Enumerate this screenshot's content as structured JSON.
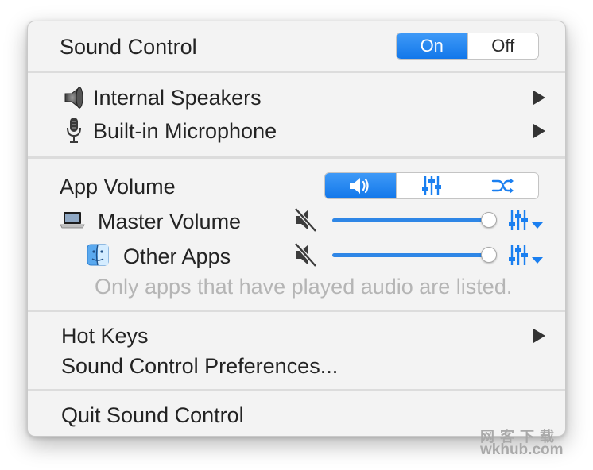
{
  "sound_control": {
    "label": "Sound Control",
    "toggle": {
      "on_label": "On",
      "off_label": "Off",
      "selected": "On"
    }
  },
  "devices": [
    {
      "label": "Internal Speakers",
      "icon": "speaker-icon"
    },
    {
      "label": "Built-in Microphone",
      "icon": "microphone-icon"
    }
  ],
  "app_volume": {
    "label": "App Volume",
    "mode_tabs": [
      {
        "icon": "volume-icon",
        "selected": true
      },
      {
        "icon": "equalizer-icon",
        "selected": false
      },
      {
        "icon": "shuffle-icon",
        "selected": false
      }
    ],
    "rows": [
      {
        "label": "Master Volume",
        "icon": "laptop-icon",
        "muted": true,
        "volume": 1.0
      },
      {
        "label": "Other Apps",
        "icon": "finder-icon",
        "muted": true,
        "volume": 1.0
      }
    ],
    "note": "Only apps that have played audio are listed."
  },
  "menu": {
    "hot_keys": "Hot Keys",
    "preferences": "Sound Control Preferences...",
    "quit": "Quit Sound Control"
  },
  "watermark": {
    "line1": "网 客 下 载",
    "line2": "wkhub.com"
  },
  "colors": {
    "accent": "#1a7ff0",
    "slider": "#2e86e6",
    "text": "#232323",
    "muted_text": "#b5b5b5"
  }
}
